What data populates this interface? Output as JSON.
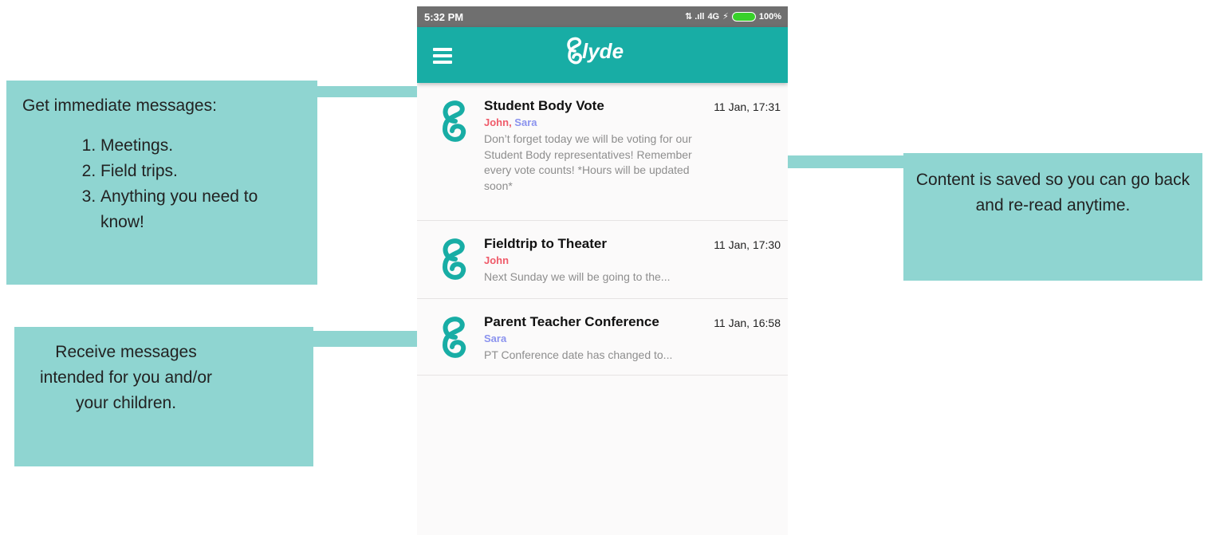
{
  "status_bar": {
    "time": "5:32 PM",
    "network": "4G",
    "battery": "100%"
  },
  "app": {
    "logo_text": "lyde"
  },
  "messages": [
    {
      "subject": "Student Body Vote",
      "date": "11 Jan, 17:31",
      "senders": [
        "John",
        "Sara"
      ],
      "preview": "Don’t forget today we will be voting for our Student Body representatives! Remember every vote counts! *Hours will be updated soon*"
    },
    {
      "subject": "Fieldtrip to Theater",
      "date": "11 Jan, 17:30",
      "senders": [
        "John"
      ],
      "preview": "Next Sunday we will be going to the..."
    },
    {
      "subject": "Parent Teacher Conference",
      "date": "11 Jan, 16:58",
      "senders": [
        "Sara"
      ],
      "preview": "PT Conference date has changed to..."
    }
  ],
  "callouts": {
    "immediate": {
      "heading": "Get immediate messages:",
      "items": [
        "Meetings.",
        "Field trips.",
        "Anything you need to know!"
      ]
    },
    "intended": {
      "text": "Receive messages intended for you and/or your children."
    },
    "saved": {
      "text": "Content is saved so you can go back and re-read anytime."
    }
  },
  "colors": {
    "teal": "#18ada5",
    "callout": "#8fd5d1",
    "john": "#ef5b6a",
    "sara": "#8b93ee"
  }
}
